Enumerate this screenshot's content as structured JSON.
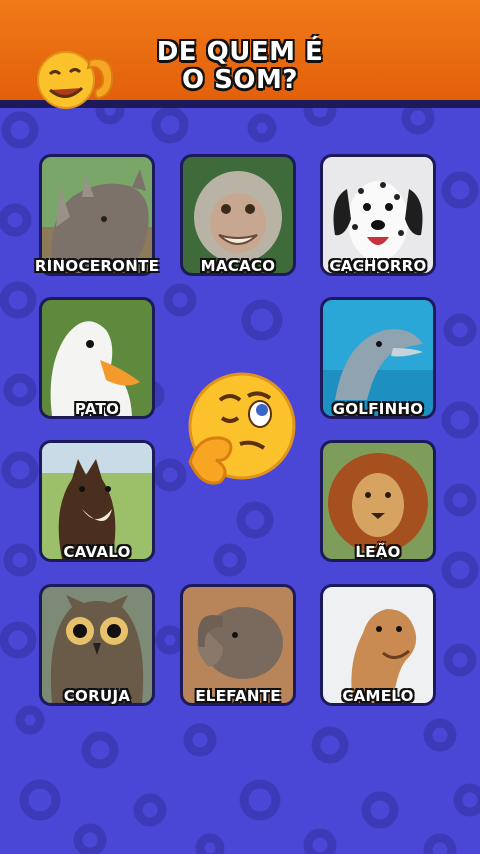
{
  "header": {
    "title_line1": "DE QUEM É",
    "title_line2": "O SOM?",
    "color": "#ea6c10"
  },
  "background_color": "#4a47d6",
  "cards": [
    {
      "name": "rhino",
      "label": "RINOCERONTE",
      "icon": "rhino"
    },
    {
      "name": "monkey",
      "label": "MACACO",
      "icon": "monkey"
    },
    {
      "name": "dog",
      "label": "CACHORRO",
      "icon": "dalmatian"
    },
    {
      "name": "duck",
      "label": "PATO",
      "icon": "duck"
    },
    {
      "name": "dolphin",
      "label": "GOLFINHO",
      "icon": "dolphin"
    },
    {
      "name": "horse",
      "label": "CAVALO",
      "icon": "horse"
    },
    {
      "name": "lion",
      "label": "LEÃO",
      "icon": "lion"
    },
    {
      "name": "owl",
      "label": "CORUJA",
      "icon": "owl"
    },
    {
      "name": "elephant",
      "label": "ELEFANTE",
      "icon": "elephant"
    },
    {
      "name": "camel",
      "label": "CAMELO",
      "icon": "camel"
    }
  ],
  "emojis": {
    "corner": "listening-emoji",
    "center": "thinking-emoji"
  }
}
